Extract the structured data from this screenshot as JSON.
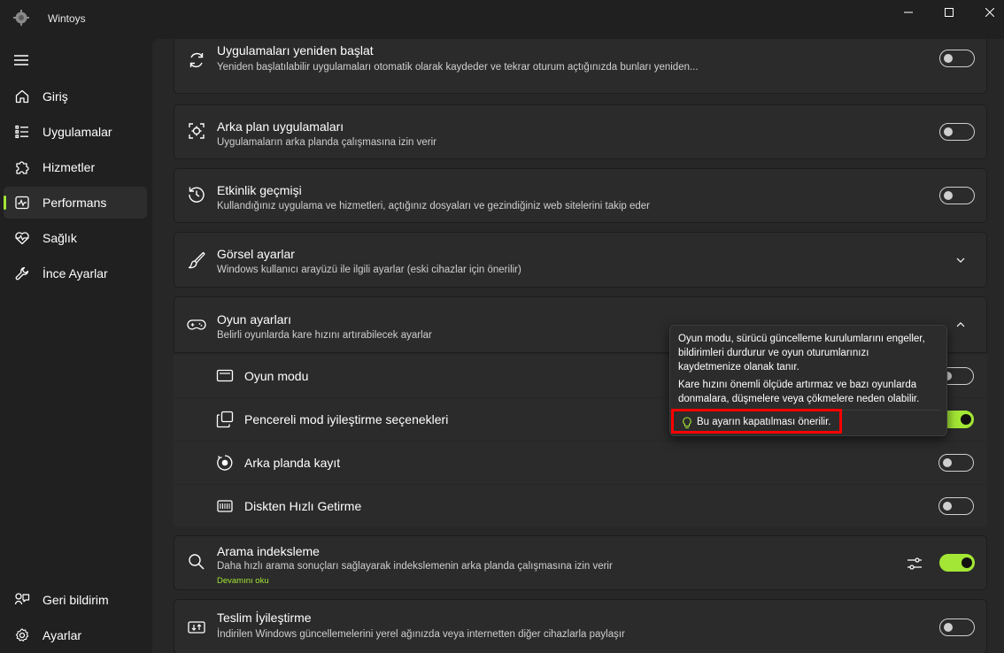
{
  "window": {
    "title": "Wintoys",
    "accent": "#a3e635"
  },
  "sidebar": {
    "items": [
      {
        "label": "Giriş",
        "icon": "home-icon"
      },
      {
        "label": "Uygulamalar",
        "icon": "apps-list-icon"
      },
      {
        "label": "Hizmetler",
        "icon": "puzzle-icon"
      },
      {
        "label": "Performans",
        "icon": "performance-icon",
        "active": true
      },
      {
        "label": "Sağlık",
        "icon": "heartbeat-icon"
      },
      {
        "label": "İnce Ayarlar",
        "icon": "wrench-icon"
      }
    ],
    "footer": [
      {
        "label": "Geri bildirim",
        "icon": "feedback-icon"
      },
      {
        "label": "Ayarlar",
        "icon": "gear-icon"
      }
    ]
  },
  "settings": {
    "restart_apps": {
      "title": "Uygulamaları yeniden başlat",
      "desc": "Yeniden başlatılabilir uygulamaları otomatik olarak kaydeder ve tekrar oturum açtığınızda bunları yeniden...",
      "on": false
    },
    "background_apps": {
      "title": "Arka plan uygulamaları",
      "desc": "Uygulamaların arka planda çalışmasına izin verir",
      "on": false
    },
    "activity_history": {
      "title": "Etkinlik geçmişi",
      "desc": "Kullandığınız uygulama ve hizmetleri, açtığınız dosyaları ve gezindiğiniz web sitelerini takip eder",
      "on": false
    },
    "visual_settings": {
      "title": "Görsel ayarlar",
      "desc": "Windows kullanıcı arayüzü ile ilgili ayarlar (eski cihazlar için önerilir)"
    },
    "game_settings": {
      "title": "Oyun ayarları",
      "desc": "Belirli oyunlarda kare hızını artırabilecek ayarlar",
      "items": [
        {
          "label": "Oyun modu",
          "on": false
        },
        {
          "label": "Pencereli mod iyileştirme seçenekleri",
          "on": true
        },
        {
          "label": "Arka planda kayıt",
          "on": false
        },
        {
          "label": "Diskten Hızlı Getirme",
          "on": false
        }
      ]
    },
    "search_indexing": {
      "title": "Arama indeksleme",
      "desc": "Daha hızlı arama sonuçları sağlayarak indekslemenin arka planda çalışmasına izin verir",
      "link": "Devamını oku",
      "on": true
    },
    "delivery_optimization": {
      "title": "Teslim İyileştirme",
      "desc": "İndirilen Windows güncellemelerini yerel ağınızda veya internetten diğer cihazlarla paylaşır",
      "on": false
    }
  },
  "tooltip": {
    "lines": [
      "Oyun modu, sürücü güncelleme kurulumlarını engeller,",
      "bildirimleri durdurur ve oyun oturumlarınızı",
      "kaydetmenize olanak tanır.",
      "Kare hızını önemli ölçüde artırmaz ve bazı oyunlarda",
      "donmalara, düşmelere veya çökmelere neden olabilir."
    ],
    "recommendation": "Bu ayarın kapatılması önerilir."
  }
}
